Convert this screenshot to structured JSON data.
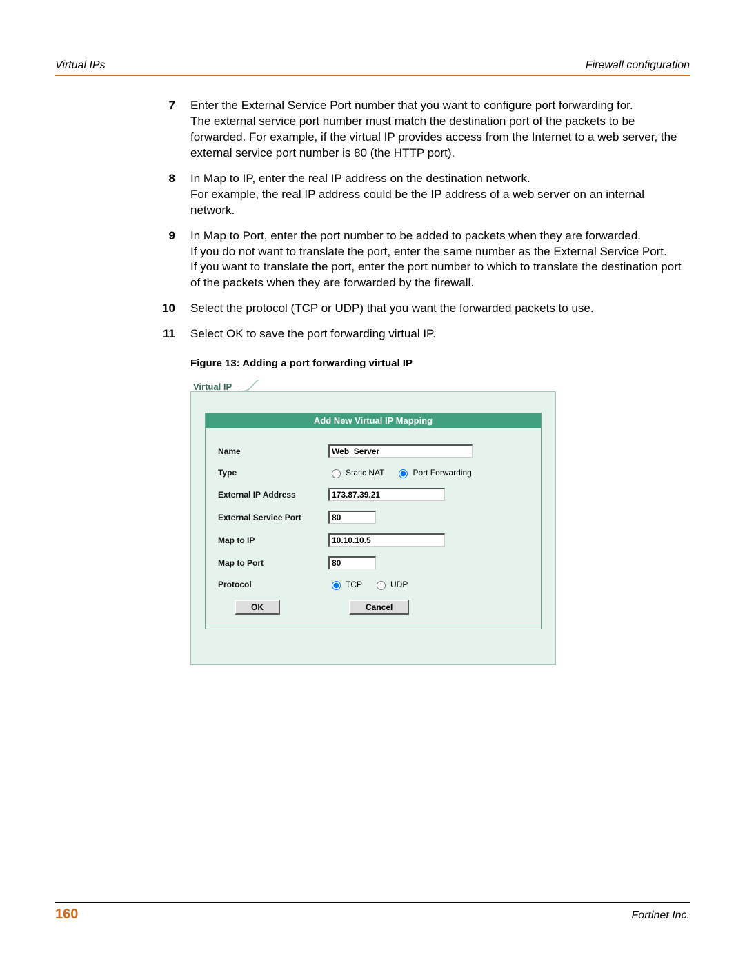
{
  "header": {
    "left": "Virtual IPs",
    "right": "Firewall configuration"
  },
  "steps": [
    {
      "num": "7",
      "paras": [
        "Enter the External Service Port number that you want to configure port forwarding for.",
        "The external service port number must match the destination port of the packets to be forwarded. For example, if the virtual IP provides access from the Internet to a web server, the external service port number is 80 (the HTTP port)."
      ]
    },
    {
      "num": "8",
      "paras": [
        "In Map to IP, enter the real IP address on the destination network.",
        "For example, the real IP address could be the IP address of a web server on an internal network."
      ]
    },
    {
      "num": "9",
      "paras": [
        "In Map to Port, enter the port number to be added to packets when they are forwarded.",
        "If you do not want to translate the port, enter the same number as the External Service Port.",
        "If you want to translate the port, enter the port number to which to translate the destination port of the packets when they are forwarded by the firewall."
      ]
    },
    {
      "num": "10",
      "paras": [
        "Select the protocol (TCP or UDP) that you want the forwarded packets to use."
      ]
    },
    {
      "num": "11",
      "paras": [
        "Select OK to save the port forwarding virtual IP."
      ]
    }
  ],
  "figure_caption": "Figure 13: Adding a port forwarding virtual IP",
  "form": {
    "tab": "Virtual IP",
    "title": "Add New Virtual IP Mapping",
    "labels": {
      "name": "Name",
      "type": "Type",
      "ext_ip": "External IP Address",
      "ext_port": "External Service Port",
      "map_ip": "Map to IP",
      "map_port": "Map to Port",
      "protocol": "Protocol"
    },
    "values": {
      "name": "Web_Server",
      "ext_ip": "173.87.39.21",
      "ext_port": "80",
      "map_ip": "10.10.10.5",
      "map_port": "80"
    },
    "type_options": {
      "static_nat": "Static NAT",
      "port_fwd": "Port Forwarding"
    },
    "protocol_options": {
      "tcp": "TCP",
      "udp": "UDP"
    },
    "buttons": {
      "ok": "OK",
      "cancel": "Cancel"
    }
  },
  "footer": {
    "page": "160",
    "company": "Fortinet Inc."
  }
}
